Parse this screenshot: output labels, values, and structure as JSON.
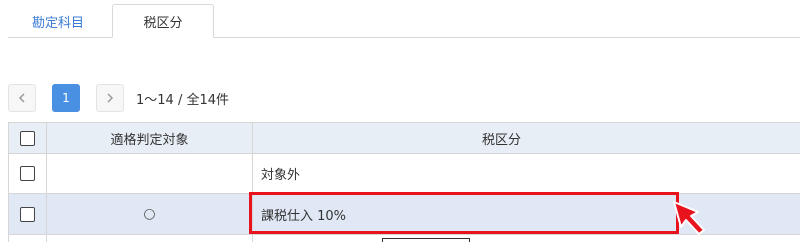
{
  "tabs": [
    {
      "label": "勘定科目",
      "active": false
    },
    {
      "label": "税区分",
      "active": true
    }
  ],
  "pagination": {
    "current_page": "1",
    "range_text": "1～14 / 全14件"
  },
  "table": {
    "columns": [
      "適格判定対象",
      "税区分"
    ],
    "rows": [
      {
        "target": "",
        "tax_category": "対象外",
        "selected": false
      },
      {
        "target": "○",
        "tax_category": "課税仕入 10%",
        "selected": false,
        "highlighted": true
      }
    ]
  },
  "colors": {
    "accent": "#4a90e2",
    "tab_link": "#3a7bd5",
    "header_bg": "#e8eef6",
    "highlight_row_bg": "#dfe8f4",
    "annotation_red": "#e8131c"
  },
  "icons": [
    "chevron-left-icon",
    "chevron-right-icon",
    "checkbox-icon",
    "annotation-arrow-icon"
  ]
}
